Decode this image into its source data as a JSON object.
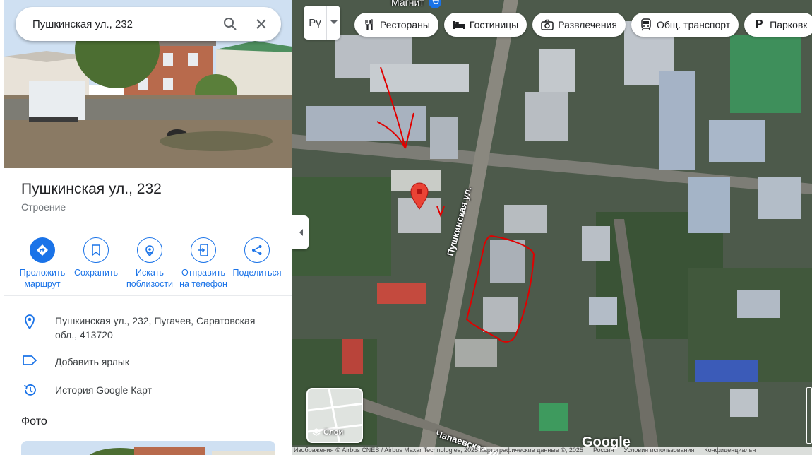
{
  "search": {
    "value": "Пушкинская ул., 232"
  },
  "place": {
    "title": "Пушкинская ул., 232",
    "category": "Строение"
  },
  "actions": [
    {
      "label": "Проложить маршрут",
      "icon": "directions-icon"
    },
    {
      "label": "Сохранить",
      "icon": "bookmark-icon"
    },
    {
      "label": "Искать поблизости",
      "icon": "nearby-icon"
    },
    {
      "label": "Отправить на телефон",
      "icon": "send-to-phone-icon"
    },
    {
      "label": "Поделиться",
      "icon": "share-icon"
    }
  ],
  "info": {
    "address": "Пушкинская ул., 232, Пугачев, Саратовская обл., 413720",
    "add_label": "Добавить ярлык",
    "history": "История Google Карт"
  },
  "photos": {
    "heading": "Фото"
  },
  "map": {
    "language": "Рү",
    "chips": [
      {
        "label": "Рестораны",
        "icon": "restaurant-icon"
      },
      {
        "label": "Гостиницы",
        "icon": "hotel-icon"
      },
      {
        "label": "Развлечения",
        "icon": "camera-icon"
      },
      {
        "label": "Общ. транспорт",
        "icon": "transit-icon"
      },
      {
        "label": "Парковк",
        "icon": "parking-icon"
      }
    ],
    "poi": "Магнит",
    "streets": {
      "pushkinskaya": "Пушкинская ул.",
      "chapaevskaya": "Чапаевская ул."
    },
    "layers_label": "Слои",
    "logo": "Google",
    "attribution": {
      "imagery": "Изображения © Airbus CNES / Airbus Maxar Technologies, 2025 Картографические данные ©, 2025",
      "country": "Россия",
      "terms": "Условия использования",
      "privacy": "Конфиденциальн"
    }
  },
  "colors": {
    "accent": "#1a73e8",
    "pin": "#ea4335",
    "drawing": "#e00000"
  }
}
